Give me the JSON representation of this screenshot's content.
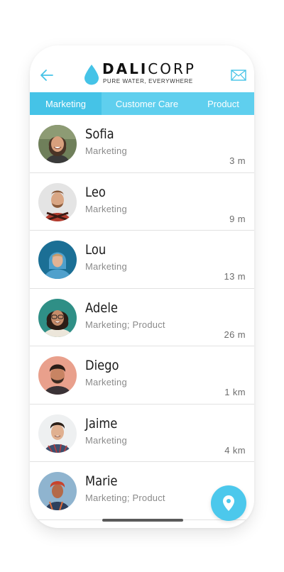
{
  "header": {
    "brand_bold": "DALI",
    "brand_light": "CORP",
    "tagline": "PURE WATER, EVERYWHERE",
    "back_icon": "arrow-left-icon",
    "mail_icon": "envelope-icon",
    "accent_color": "#45c3e7"
  },
  "tabs": [
    {
      "label": "Marketing",
      "active": true
    },
    {
      "label": "Customer Care",
      "active": false
    },
    {
      "label": "Product",
      "active": false
    }
  ],
  "contacts": [
    {
      "name": "Sofia",
      "department": "Marketing",
      "distance": "3 m"
    },
    {
      "name": "Leo",
      "department": "Marketing",
      "distance": "9 m"
    },
    {
      "name": "Lou",
      "department": "Marketing",
      "distance": "13 m"
    },
    {
      "name": "Adele",
      "department": "Marketing; Product",
      "distance": "26 m"
    },
    {
      "name": "Diego",
      "department": "Marketing",
      "distance": "1 km"
    },
    {
      "name": "Jaime",
      "department": "Marketing",
      "distance": "4 km"
    },
    {
      "name": "Marie",
      "department": "Marketing; Product",
      "distance": ""
    }
  ],
  "fab": {
    "icon": "map-pin-icon"
  }
}
